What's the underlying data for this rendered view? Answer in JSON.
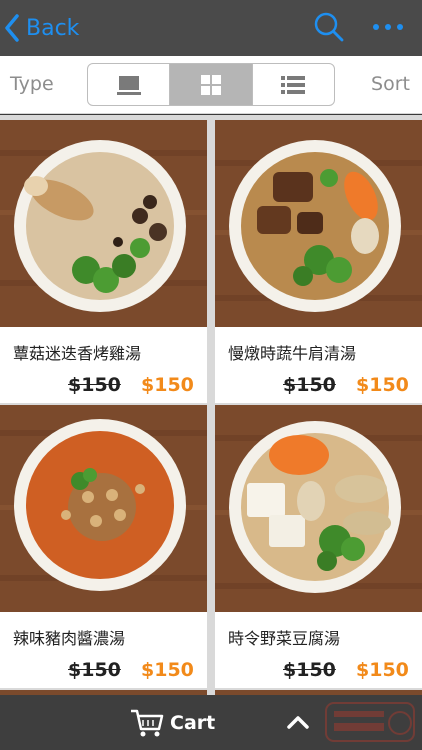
{
  "nav": {
    "back_label": "Back"
  },
  "filter": {
    "type_label": "Type",
    "sort_label": "Sort",
    "views": [
      "single-view",
      "grid-view",
      "list-view"
    ],
    "active_view": "grid-view"
  },
  "products": [
    {
      "name": "蕈菇迷迭香烤雞湯",
      "old_price": "$150",
      "price": "$150"
    },
    {
      "name": "慢燉時蔬牛肩清湯",
      "old_price": "$150",
      "price": "$150"
    },
    {
      "name": "辣味豬肉醬濃湯",
      "old_price": "$150",
      "price": "$150"
    },
    {
      "name": "時令野菜豆腐湯",
      "old_price": "$150",
      "price": "$150"
    }
  ],
  "bottom": {
    "cart_label": "Cart"
  },
  "colors": {
    "accent": "#1e8ff0",
    "price": "#f28a1a"
  }
}
